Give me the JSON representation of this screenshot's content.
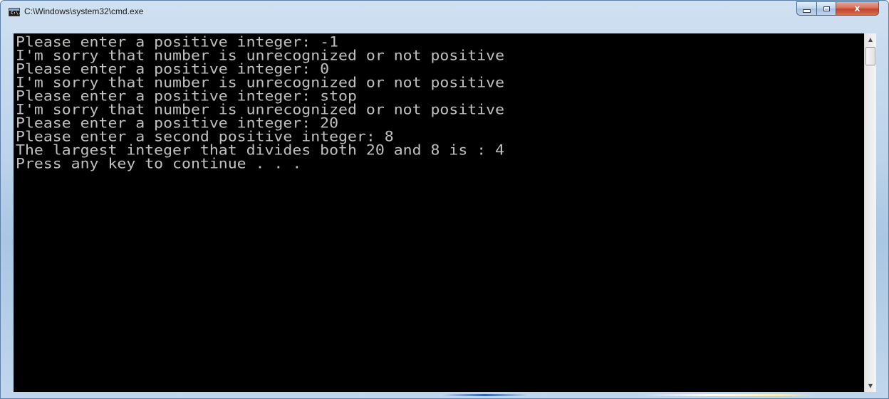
{
  "window": {
    "title": "C:\\Windows\\system32\\cmd.exe",
    "app_icon_text": "C:\\."
  },
  "caption_buttons": {
    "minimize": "minimize-icon",
    "maximize": "maximize-icon",
    "close_glyph": "x"
  },
  "console": {
    "lines": [
      "Please enter a positive integer: -1",
      "I'm sorry that number is unrecognized or not positive",
      "Please enter a positive integer: 0",
      "I'm sorry that number is unrecognized or not positive",
      "Please enter a positive integer: stop",
      "I'm sorry that number is unrecognized or not positive",
      "Please enter a positive integer: 20",
      "Please enter a second positive integer: 8",
      "The largest integer that divides both 20 and 8 is : 4",
      "Press any key to continue . . ."
    ]
  },
  "scrollbar": {
    "up_arrow": "▲",
    "down_arrow": "▼"
  },
  "colors": {
    "console_background": "#000000",
    "console_text": "#c0c0c0",
    "close_button": "#c7452d"
  }
}
